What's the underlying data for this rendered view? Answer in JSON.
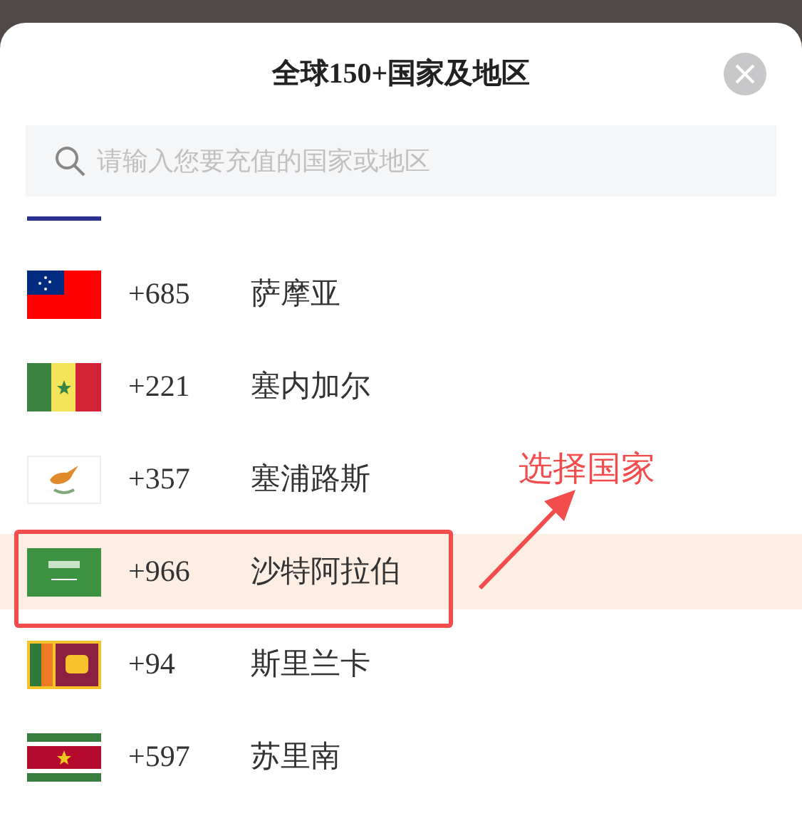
{
  "title": "全球150+国家及地区",
  "search": {
    "placeholder": "请输入您要充值的国家或地区"
  },
  "countries": [
    {
      "kind": "samoa",
      "code": "+685",
      "name": "萨摩亚",
      "selected": false
    },
    {
      "kind": "senegal",
      "code": "+221",
      "name": "塞内加尔",
      "selected": false
    },
    {
      "kind": "cyprus",
      "code": "+357",
      "name": "塞浦路斯",
      "selected": false
    },
    {
      "kind": "saudi",
      "code": "+966",
      "name": "沙特阿拉伯",
      "selected": true
    },
    {
      "kind": "srilanka",
      "code": "+94",
      "name": "斯里兰卡",
      "selected": false
    },
    {
      "kind": "suriname",
      "code": "+597",
      "name": "苏里南",
      "selected": false
    }
  ],
  "annotation": "选择国家"
}
